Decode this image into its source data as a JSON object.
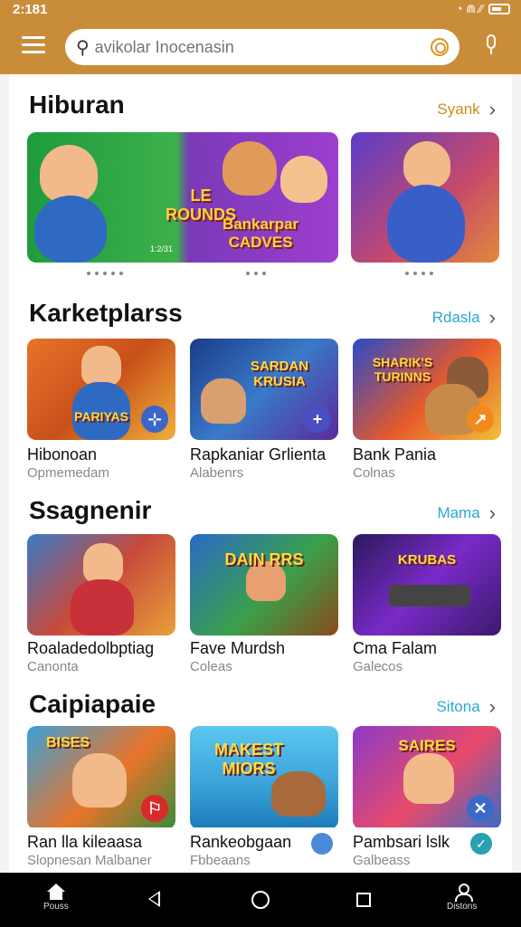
{
  "status": {
    "time": "2:181",
    "signal": "◔ ⋒ ⁄⁄",
    "battery_icon": "battery-icon"
  },
  "search": {
    "placeholder": "avikolar Inocenasin"
  },
  "sections": [
    {
      "title": "Hiburan",
      "link": "Syank",
      "link_color": "#d08a1a"
    },
    {
      "title": "Karketplarss",
      "link": "Rdasla",
      "link_color": "#2ba8d1"
    },
    {
      "title": "Ssagnenir",
      "link": "Mama",
      "link_color": "#2ba8d1"
    },
    {
      "title": "Caipiapaie",
      "link": "Sitona",
      "link_color": "#2ba8d1"
    }
  ],
  "hero": [
    {
      "art": "LE ROUNDS",
      "art2": "",
      "caption": "1:2/31"
    },
    {
      "art": "Bankarpar",
      "art2": "CADVES",
      "caption": ""
    },
    {
      "art": "",
      "art2": "",
      "caption": ""
    }
  ],
  "marketplace": [
    {
      "name": "Hibonoan",
      "sub": "Opmemedam",
      "art": "PARIYAS",
      "badge_color": "#3b66c8",
      "badge": "⊹"
    },
    {
      "name": "Rapkaniar Grlienta",
      "sub": "Alabenrs",
      "art": "SARDAN KRUSIA",
      "badge_color": "#4a4ec2",
      "badge": "+"
    },
    {
      "name": "Bank Pania",
      "sub": "Colnas",
      "art": "SHARIK'S TURINNS",
      "badge_color": "#f08a1a",
      "badge": "↗"
    }
  ],
  "shop": [
    {
      "name": "Roaladedolbptiag",
      "sub": "Canonta",
      "art": ""
    },
    {
      "name": "Fave Murdsh",
      "sub": "Coleas",
      "art": "DAIN RRS"
    },
    {
      "name": "Cma Falam",
      "sub": "Galecos",
      "art": "KRUBAS"
    }
  ],
  "campaign": [
    {
      "name": "Ran lla kileaasa",
      "sub": "Slopnesan Malbaner",
      "art": "BISES",
      "badge_color": "#d82a2a",
      "badge": "⚐"
    },
    {
      "name": "Rankeobgaan",
      "sub": "Fbbeaans",
      "art": "MAKEST MIORS",
      "badge_color": "#4a8ad8",
      "badge": "●"
    },
    {
      "name": "Pambsari lslk",
      "sub": "Galbeass",
      "art": "SAIRES",
      "badge_color": "#2aa0b0",
      "badge": "✓"
    }
  ],
  "nav": {
    "home": "Pouss",
    "profile": "Distons"
  }
}
